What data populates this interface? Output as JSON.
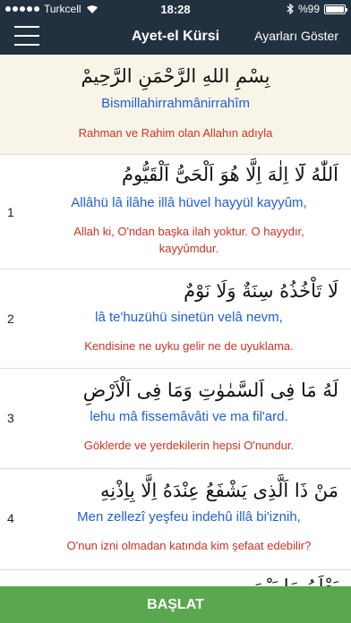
{
  "status": {
    "carrier": "Turkcell",
    "time": "18:28",
    "battery": "%99",
    "battery_level": 0.99
  },
  "navbar": {
    "title": "Ayet-el Kürsi",
    "settings_label": "Ayarları Göster",
    "menu_icon": "hamburger-icon"
  },
  "header": {
    "arabic": "بِسْمِ اللهِ الرَّحْمَنِ الرَّحِيمْ",
    "translit": "Bismillahirrahmânirrahîm",
    "meaning": "Rahman ve Rahim olan Allahın adıyla"
  },
  "verses": [
    {
      "number": "1",
      "arabic": "اَللّٰهُ لَٓا اِلٰهَ اِلَّا هُوَ اَلْحَىُّ اَلْقَيُّومُ",
      "translit": "Allâhü lâ ilâhe illâ hüvel hayyül kayyûm,",
      "meaning": "Allah ki, O'ndan başka ilah yoktur. O hayydır, kayyûmdur."
    },
    {
      "number": "2",
      "arabic": "لَا تَاْخُذُهُ سِنَةٌ وَلَا نَوْمٌ",
      "translit": "lâ te'huzühü sinetün velâ nevm,",
      "meaning": "Kendisine ne uyku gelir ne de uyuklama."
    },
    {
      "number": "3",
      "arabic": "لَهُ مَا فِى اَلسَّمٰوٰتِ وَمَا فِى اَلْاَرْضِ",
      "translit": "lehu mâ fissemâvâti ve ma fil'ard.",
      "meaning": "Göklerde ve yerdekilerin hepsi O'nundur."
    },
    {
      "number": "4",
      "arabic": "مَنْ ذَا اَلَّذِى يَشْفَعُ عِنْدَهُ اِلَّا بِاِذْنِهِ",
      "translit": "Men zellezî yeşfeu indehû illâ bi'iznih,",
      "meaning": "O'nun izni olmadan katında kim şefaat edebilir?"
    },
    {
      "number": "",
      "arabic": "يَعْلَمُ مَا بَيْنَ",
      "translit": "",
      "meaning": ""
    }
  ],
  "footer": {
    "start_label": "BAŞLAT"
  },
  "colors": {
    "navbar": "#22313f",
    "header_bg": "#f8f5e8",
    "translit": "#1f5fd6",
    "meaning": "#cc3324",
    "start_button": "#5aa84e"
  }
}
